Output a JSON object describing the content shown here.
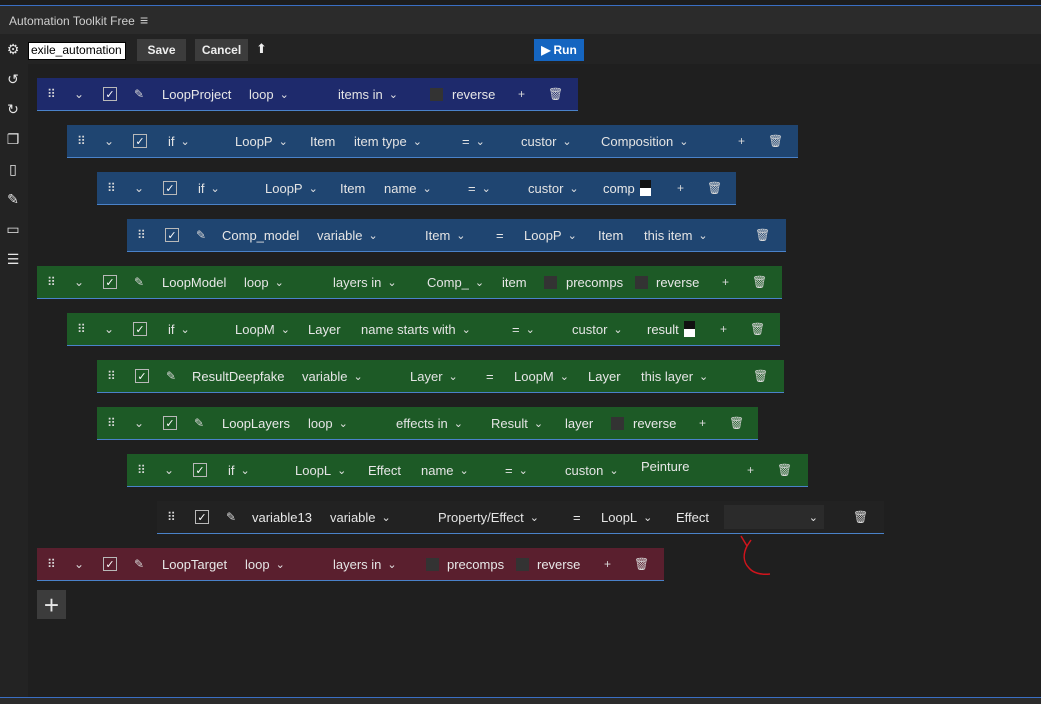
{
  "app": {
    "title": "Automation Toolkit Free",
    "menu_icon": "hamburger-icon"
  },
  "toolbar": {
    "filename": "exile_automation",
    "save_label": "Save",
    "cancel_label": "Cancel",
    "run_label": "Run",
    "upload_icon": "upload-icon"
  },
  "sidebar": {
    "icons": [
      "gear-icon",
      "undo-icon",
      "redo-icon",
      "copy-icon",
      "paste-icon",
      "brush-icon",
      "comment-icon",
      "add-list-icon"
    ]
  },
  "rows": {
    "r1": {
      "name": "LoopProject",
      "type": "loop",
      "source": "items in",
      "reverse_label": "reverse"
    },
    "r2": {
      "kw": "if",
      "var": "LoopP",
      "obj": "Item",
      "prop": "item type",
      "op": "=",
      "src": "custor",
      "value": "Composition"
    },
    "r3": {
      "kw": "if",
      "var": "LoopP",
      "obj": "Item",
      "prop": "name",
      "op": "=",
      "src": "custor",
      "value": "comp"
    },
    "r4": {
      "name": "Comp_model",
      "type": "variable",
      "what": "Item",
      "op": "=",
      "var": "LoopP",
      "obj": "Item",
      "value": "this item"
    },
    "r5": {
      "name": "LoopModel",
      "type": "loop",
      "source": "layers in",
      "var": "Comp_",
      "obj": "item",
      "precomps_label": "precomps",
      "reverse_label": "reverse"
    },
    "r6": {
      "kw": "if",
      "var": "LoopM",
      "obj": "Layer",
      "prop": "name starts with",
      "op": "=",
      "src": "custor",
      "value": "result"
    },
    "r7": {
      "name": "ResultDeepfake",
      "type": "variable",
      "what": "Layer",
      "op": "=",
      "var": "LoopM",
      "obj": "Layer",
      "value": "this layer"
    },
    "r8": {
      "name": "LoopLayers",
      "type": "loop",
      "source": "effects in",
      "var": "Result",
      "obj": "layer",
      "reverse_label": "reverse"
    },
    "r9": {
      "kw": "if",
      "var": "LoopL",
      "obj": "Effect",
      "prop": "name",
      "op": "=",
      "src": "custon",
      "value": "Peinture"
    },
    "r10": {
      "name": "variable13",
      "type": "variable",
      "what": "Property/Effect",
      "op": "=",
      "var": "LoopL",
      "obj": "Effect",
      "value": ""
    },
    "r11": {
      "name": "LoopTarget",
      "type": "loop",
      "source": "layers in",
      "precomps_label": "precomps",
      "reverse_label": "reverse"
    }
  },
  "colors": {
    "loop_blue": "#1e2a6c",
    "if_blue": "#1f4571",
    "green": "#1d5a26",
    "red": "#5a1f2e",
    "run": "#1565c0",
    "annotation": "#d0141c"
  }
}
